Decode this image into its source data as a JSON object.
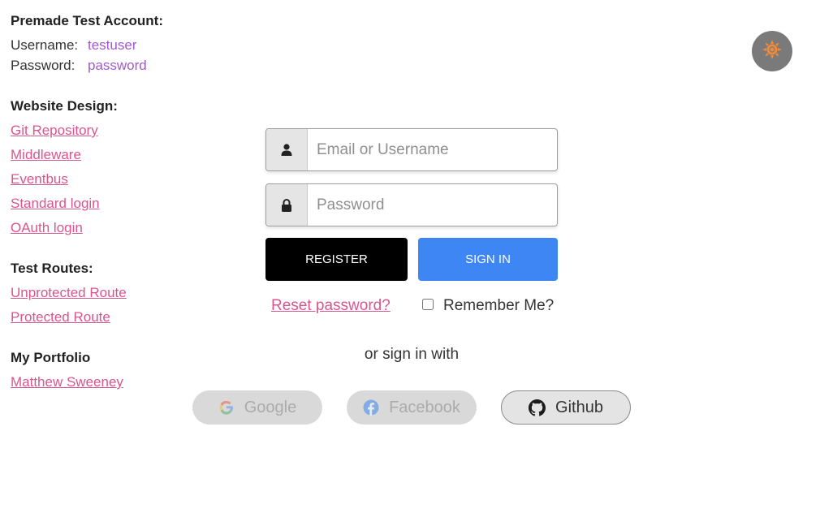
{
  "test_account": {
    "title": "Premade Test Account:",
    "username_label": "Username:",
    "username_value": "testuser",
    "password_label": "Password:",
    "password_value": "password"
  },
  "website_design": {
    "title": "Website Design:",
    "links": [
      "Git Repository",
      "Middleware",
      "Eventbus",
      "Standard login",
      "OAuth login"
    ]
  },
  "test_routes": {
    "title": "Test Routes:",
    "links": [
      "Unprotected Route",
      "Protected Route"
    ]
  },
  "portfolio": {
    "title": "My Portfolio",
    "link": "Matthew Sweeney"
  },
  "form": {
    "email_placeholder": "Email or Username",
    "password_placeholder": "Password",
    "register_label": "REGISTER",
    "signin_label": "SIGN IN",
    "reset_label": "Reset password?",
    "remember_label": "Remember Me?",
    "or_text": "or sign in with"
  },
  "social": {
    "google": "Google",
    "facebook": "Facebook",
    "github": "Github"
  },
  "icons": {
    "theme": "sun-icon",
    "user": "user-icon",
    "lock": "lock-icon",
    "google": "google-icon",
    "facebook": "facebook-icon",
    "github": "github-icon"
  },
  "colors": {
    "link": "#d9558f",
    "value": "#a15ac8",
    "signin": "#3d86f3",
    "register": "#000000",
    "theme_button": "#7a7a7a",
    "sun": "#f08a3c"
  }
}
